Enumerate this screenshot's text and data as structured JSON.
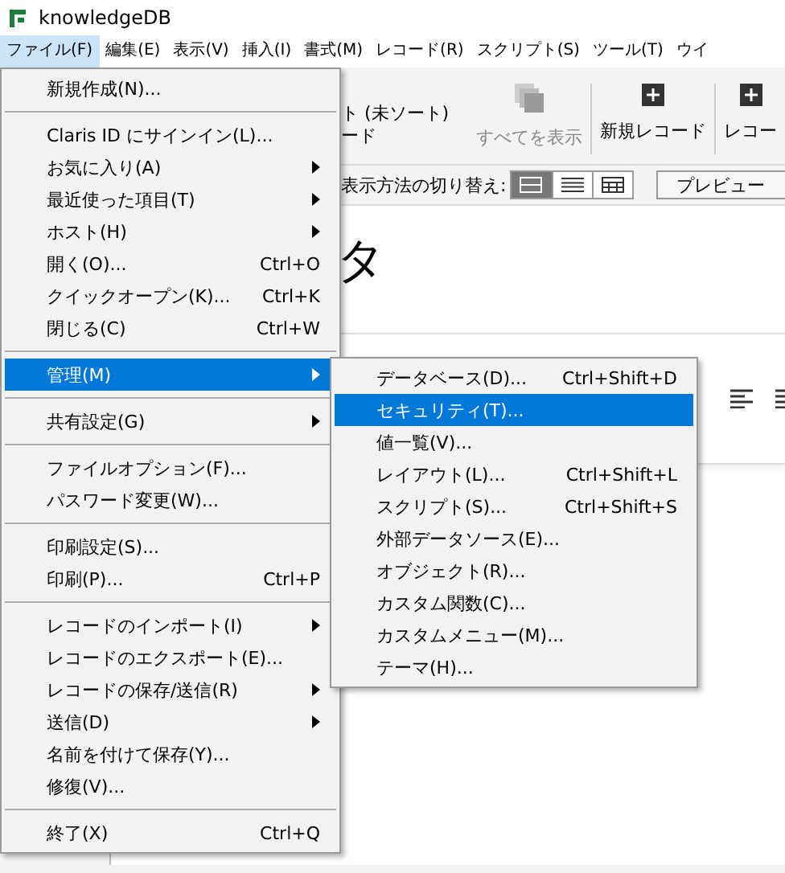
{
  "window": {
    "title": "knowledgeDB"
  },
  "menubar": [
    {
      "label": "ファイル(F)",
      "selected": true
    },
    {
      "label": "編集(E)",
      "selected": false
    },
    {
      "label": "表示(V)",
      "selected": false
    },
    {
      "label": "挿入(I)",
      "selected": false
    },
    {
      "label": "書式(M)",
      "selected": false
    },
    {
      "label": "レコード(R)",
      "selected": false
    },
    {
      "label": "スクリプト(S)",
      "selected": false
    },
    {
      "label": "ツール(T)",
      "selected": false
    },
    {
      "label": "ウイ",
      "selected": false
    }
  ],
  "toolbar": {
    "sort_status": "ト (未ソート)",
    "record_label": "ード",
    "buttons": [
      {
        "label": "すべてを表示",
        "disabled": true
      },
      {
        "label": "新規レコード",
        "disabled": false
      },
      {
        "label": "レコー",
        "disabled": false
      }
    ]
  },
  "view_switch": {
    "label": "表示方法の切り替え:",
    "modes": [
      {
        "selected": true
      },
      {
        "selected": false
      },
      {
        "selected": false
      }
    ],
    "preview": "プレビュー"
  },
  "layout": {
    "heading": "タ"
  },
  "file_menu": [
    {
      "kind": "item",
      "label": "新規作成(N)...",
      "submenu": false,
      "selected": false
    },
    {
      "kind": "separator"
    },
    {
      "kind": "item",
      "label": "Claris ID にサインイン(L)...",
      "submenu": false,
      "selected": false
    },
    {
      "kind": "item",
      "label": "お気に入り(A)",
      "submenu": true,
      "selected": false
    },
    {
      "kind": "item",
      "label": "最近使った項目(T)",
      "submenu": true,
      "selected": false
    },
    {
      "kind": "item",
      "label": "ホスト(H)",
      "submenu": true,
      "selected": false
    },
    {
      "kind": "item",
      "label": "開く(O)...",
      "shortcut": "Ctrl+O",
      "submenu": false,
      "selected": false
    },
    {
      "kind": "item",
      "label": "クイックオープン(K)...",
      "shortcut": "Ctrl+K",
      "submenu": false,
      "selected": false
    },
    {
      "kind": "item",
      "label": "閉じる(C)",
      "shortcut": "Ctrl+W",
      "submenu": false,
      "selected": false
    },
    {
      "kind": "separator"
    },
    {
      "kind": "item",
      "label": "管理(M)",
      "submenu": true,
      "selected": true
    },
    {
      "kind": "separator"
    },
    {
      "kind": "item",
      "label": "共有設定(G)",
      "submenu": true,
      "selected": false
    },
    {
      "kind": "separator"
    },
    {
      "kind": "item",
      "label": "ファイルオプション(F)...",
      "submenu": false,
      "selected": false
    },
    {
      "kind": "item",
      "label": "パスワード変更(W)...",
      "submenu": false,
      "selected": false
    },
    {
      "kind": "separator"
    },
    {
      "kind": "item",
      "label": "印刷設定(S)...",
      "submenu": false,
      "selected": false
    },
    {
      "kind": "item",
      "label": "印刷(P)...",
      "shortcut": "Ctrl+P",
      "submenu": false,
      "selected": false
    },
    {
      "kind": "separator"
    },
    {
      "kind": "item",
      "label": "レコードのインポート(I)",
      "submenu": true,
      "selected": false
    },
    {
      "kind": "item",
      "label": "レコードのエクスポート(E)...",
      "submenu": false,
      "selected": false
    },
    {
      "kind": "item",
      "label": "レコードの保存/送信(R)",
      "submenu": true,
      "selected": false
    },
    {
      "kind": "item",
      "label": "送信(D)",
      "submenu": true,
      "selected": false
    },
    {
      "kind": "item",
      "label": "名前を付けて保存(Y)...",
      "submenu": false,
      "selected": false
    },
    {
      "kind": "item",
      "label": "修復(V)...",
      "submenu": false,
      "selected": false
    },
    {
      "kind": "separator"
    },
    {
      "kind": "item",
      "label": "終了(X)",
      "shortcut": "Ctrl+Q",
      "submenu": false,
      "selected": false
    }
  ],
  "manage_submenu": [
    {
      "label": "データベース(D)...",
      "shortcut": "Ctrl+Shift+D",
      "selected": false
    },
    {
      "label": "セキュリティ(T)...",
      "selected": true
    },
    {
      "label": "値一覧(V)...",
      "selected": false
    },
    {
      "label": "レイアウト(L)...",
      "shortcut": "Ctrl+Shift+L",
      "selected": false
    },
    {
      "label": "スクリプト(S)...",
      "shortcut": "Ctrl+Shift+S",
      "selected": false
    },
    {
      "label": "外部データソース(E)...",
      "selected": false
    },
    {
      "label": "オブジェクト(R)...",
      "selected": false
    },
    {
      "label": "カスタム関数(C)...",
      "selected": false
    },
    {
      "label": "カスタムメニュー(M)...",
      "selected": false
    },
    {
      "label": "テーマ(H)...",
      "selected": false
    }
  ]
}
